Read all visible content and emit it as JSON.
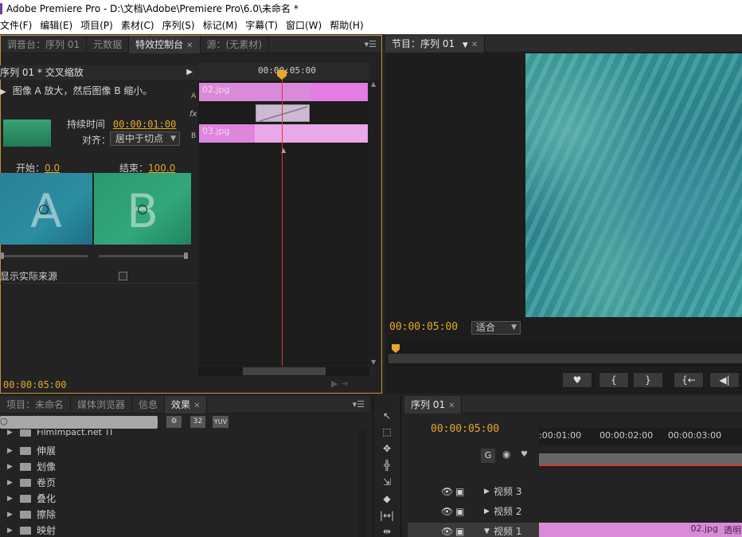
{
  "window": {
    "title": "Adobe Premiere Pro - D:\\文档\\Adobe\\Premiere Pro\\6.0\\未命名 *"
  },
  "menu": [
    "文件(F)",
    "编辑(E)",
    "项目(P)",
    "素材(C)",
    "序列(S)",
    "标记(M)",
    "字幕(T)",
    "窗口(W)",
    "帮助(H)"
  ],
  "fx_panel": {
    "tabs": [
      "调音台：序列 01",
      "元数据",
      "特效控制台",
      "源：(无素材)"
    ],
    "active_tab": "特效控制台",
    "sequence_header": "序列 01 * 交叉缩放",
    "description": "图像 A 放大，然后图像 B 缩小。",
    "duration_label": "持续时间",
    "duration_value": "00:00:01:00",
    "align_label": "对齐：",
    "align_value": "居中于切点",
    "start_label": "开始：",
    "start_value": "0.0",
    "end_label": "结束：",
    "end_value": "100.0",
    "thumb_a": "A",
    "thumb_b": "B",
    "show_actual_sources": "显示实际来源",
    "timeline_time": "00:00:05:00",
    "clip_a_name": "02.jpg",
    "clip_b_name": "03.jpg",
    "track_a": "A",
    "track_b": "B",
    "fx_label": "fx",
    "footer_time": "00:00:05:00"
  },
  "program": {
    "tab": "节目：序列 01",
    "timecode": "00:00:05:00",
    "fit": "适合"
  },
  "project": {
    "tabs": [
      "项目：未命名",
      "媒体浏览器",
      "信息",
      "效果"
    ],
    "active_tab": "效果",
    "filter_icons": [
      "32",
      "YUV"
    ],
    "folders": [
      "FilmImpact.net TI",
      "伸展",
      "划像",
      "卷页",
      "叠化",
      "擦除",
      "映射"
    ]
  },
  "sequence": {
    "tab": "序列 01",
    "timecode": "00:00:05:00",
    "ruler": [
      ":00:01:00",
      "00:00:02:00",
      "00:00:03:00"
    ],
    "tracks": [
      "视频 3",
      "视频 2",
      "视频 1"
    ],
    "clip_label": "02.jpg",
    "clip_label_2": "透明"
  },
  "colors": {
    "accent": "#e8a72a",
    "clip": "#d98ad9",
    "playhead": "#d23b3b"
  }
}
